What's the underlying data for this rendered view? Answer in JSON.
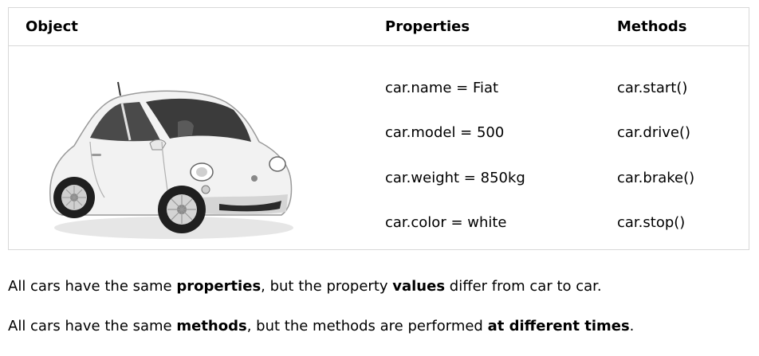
{
  "table": {
    "headers": {
      "object": "Object",
      "properties": "Properties",
      "methods": "Methods"
    },
    "properties": [
      "car.name = Fiat",
      "car.model = 500",
      "car.weight = 850kg",
      "car.color = white"
    ],
    "methods": [
      "car.start()",
      "car.drive()",
      "car.brake()",
      "car.stop()"
    ]
  },
  "paragraphs": {
    "p1": {
      "t1": "All cars have the same ",
      "b1": "properties",
      "t2": ", but the property ",
      "b2": "values",
      "t3": " differ from car to car."
    },
    "p2": {
      "t1": "All cars have the same ",
      "b1": "methods",
      "t2": ", but the methods are performed ",
      "b2": "at different times",
      "t3": "."
    }
  }
}
